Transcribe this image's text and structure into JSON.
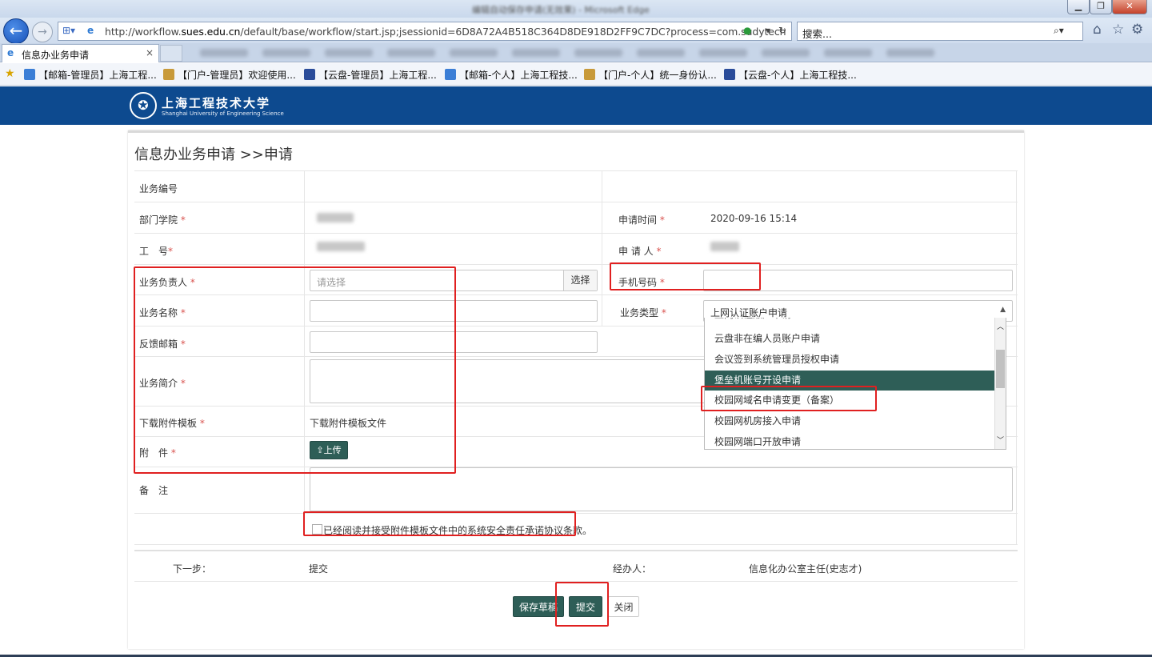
{
  "window": {
    "title": "编辑自动保存申请(无效果) - Microsoft Edge"
  },
  "browser": {
    "url_prefix": "http://workflow.",
    "url_domain": "sues.edu.cn",
    "url_rest": "/default/base/workflow/start.jsp;jsessionid=6D8A72A4B518C364D8DE918D2FF9C7DC?process=com.sudytech",
    "search_placeholder": "搜索...",
    "tab_label": "信息办业务申请",
    "tab_close": "×",
    "favorites": [
      "【邮箱-管理员】上海工程...",
      "【门户-管理员】欢迎使用...",
      "【云盘-管理员】上海工程...",
      "【邮箱-个人】上海工程技...",
      "【门户-个人】统一身份认...",
      "【云盘-个人】上海工程技..."
    ]
  },
  "site": {
    "logo_cn": "上海工程技术大学",
    "logo_en": "Shanghai University of Engineering Science"
  },
  "page": {
    "title": "信息办业务申请 >>申请"
  },
  "form": {
    "biz_no_label": "业务编号",
    "dept_label": "部门学院",
    "apply_time_label": "申请时间",
    "apply_time_value": "2020-09-16 15:14",
    "staff_no_label": "工　号",
    "applicant_label": "申 请 人",
    "owner_label": "业务负责人",
    "owner_placeholder": "请选择",
    "select_button": "选择",
    "phone_label": "手机号码",
    "name_label": "业务名称",
    "type_label": "业务类型",
    "type_value": "上网认证账户申请",
    "email_label": "反馈邮箱",
    "intro_label": "业务简介",
    "template_label": "下载附件模板",
    "template_link": "下载附件模板文件",
    "attach_label": "附　件",
    "upload_button": "上传",
    "remark_label": "备　注",
    "agree_text": "已经阅读并接受附件模板文件中的系统安全责任承诺协议条款。",
    "required_mark": "*"
  },
  "dropdown": {
    "options": [
      "上网认证账户申请",
      "云盘非在编人员账户申请",
      "会议签到系统管理员授权申请",
      "堡垒机账号开设申请",
      "校园网域名申请变更（备案）",
      "校园网机房接入申请",
      "校园网端口开放申请"
    ],
    "selected_index": 3
  },
  "workflow": {
    "next_label": "下一步：",
    "next_value": "提交",
    "handler_label": "经办人：",
    "handler_value": "信息化办公室主任(史志才)"
  },
  "actions": {
    "save_draft": "保存草稿",
    "submit": "提交",
    "close": "关闭"
  },
  "colors": {
    "header_blue": "#0d4a8f",
    "button_green": "#2e5e57",
    "annotation_red": "#e02020",
    "required_red": "#d9534f"
  }
}
